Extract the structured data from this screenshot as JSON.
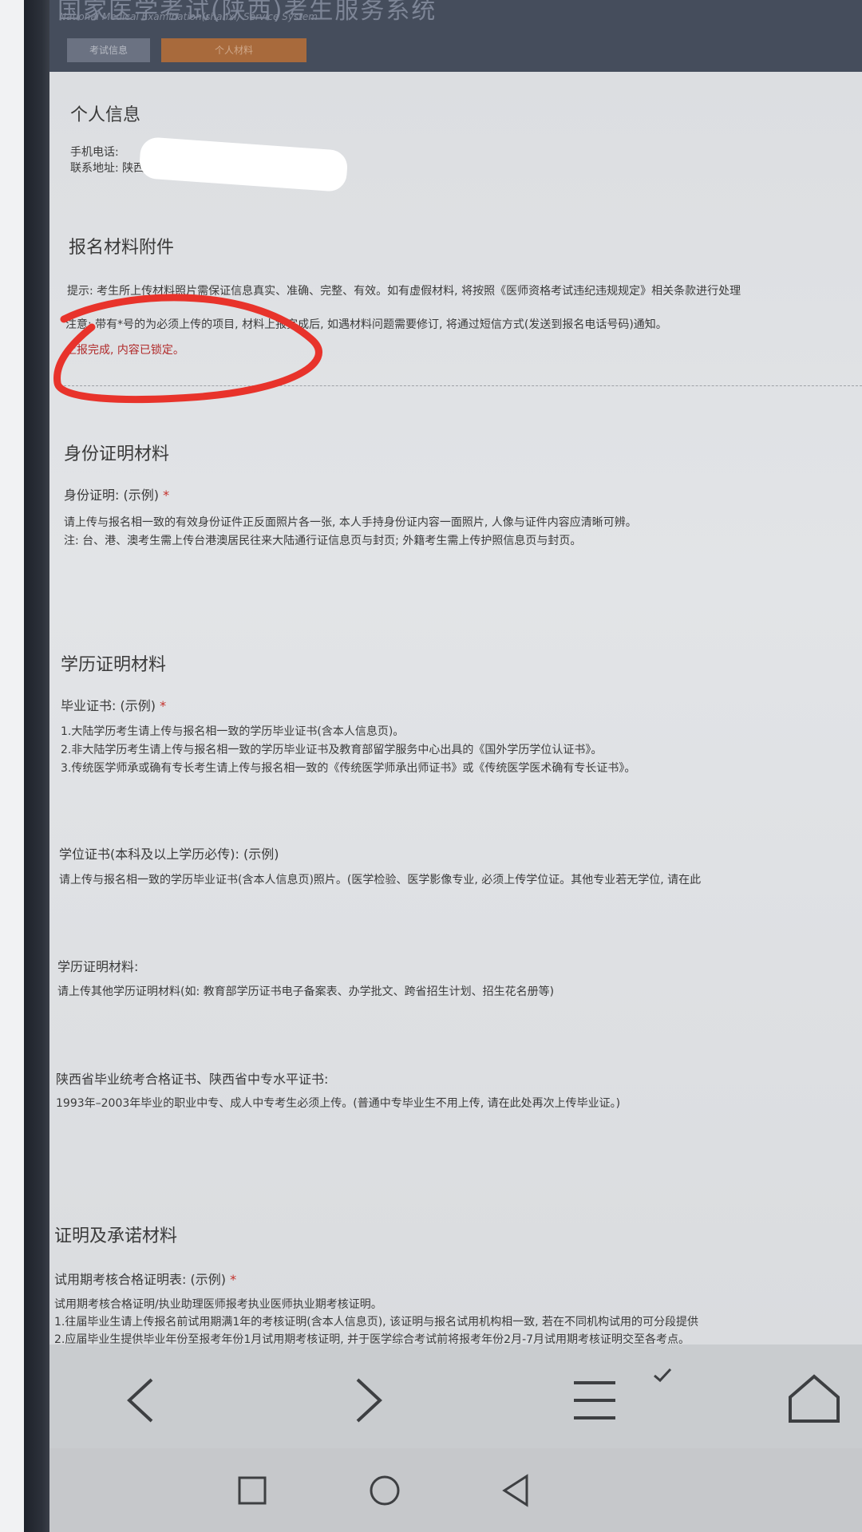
{
  "header": {
    "title": "国家医学考试(陕西)考生服务系统",
    "subtitle": "National Medical Examination(shanxi) Service System",
    "tabs": [
      {
        "label": "考试信息"
      },
      {
        "label": "个人材料"
      }
    ]
  },
  "personal": {
    "heading": "个人信息",
    "phone_label": "手机电话:",
    "address_label": "联系地址: 陕西"
  },
  "attachments": {
    "heading": "报名材料附件",
    "tip": "提示: 考生所上传材料照片需保证信息真实、准确、完整、有效。如有虚假材料, 将按照《医师资格考试违纪违规规定》相关条款进行处理",
    "note": "注意: 带有*号的为必须上传的项目, 材料上报完成后, 如遇材料问题需要修订, 将通过短信方式(发送到报名电话号码)通知。",
    "locked": "上报完成, 内容已锁定。"
  },
  "identity": {
    "heading": "身份证明材料",
    "label": "身份证明: (示例)",
    "star": "*",
    "line1": "请上传与报名相一致的有效身份证件正反面照片各一张, 本人手持身份证内容一面照片, 人像与证件内容应清晰可辨。",
    "line2": "注: 台、港、澳考生需上传台港澳居民往来大陆通行证信息页与封页; 外籍考生需上传护照信息页与封页。"
  },
  "education": {
    "heading": "学历证明材料",
    "diploma_label": "毕业证书: (示例)",
    "diploma_star": "*",
    "diploma_lines": [
      "1.大陆学历考生请上传与报名相一致的学历毕业证书(含本人信息页)。",
      "2.非大陆学历考生请上传与报名相一致的学历毕业证书及教育部留学服务中心出具的《国外学历学位认证书》。",
      "3.传统医学师承或确有专长考生请上传与报名相一致的《传统医学师承出师证书》或《传统医学医术确有专长证书》。"
    ],
    "degree_label": "学位证书(本科及以上学历必传): (示例)",
    "degree_line": "请上传与报名相一致的学历毕业证书(含本人信息页)照片。(医学检验、医学影像专业, 必须上传学位证。其他专业若无学位, 请在此",
    "other_label": "学历证明材料:",
    "other_line": "请上传其他学历证明材料(如: 教育部学历证书电子备案表、办学批文、跨省招生计划、招生花名册等)",
    "shaanxi_label": "陕西省毕业统考合格证书、陕西省中专水平证书:",
    "shaanxi_line": "1993年–2003年毕业的职业中专、成人中专考生必须上传。(普通中专毕业生不用上传, 请在此处再次上传毕业证。)"
  },
  "commitment": {
    "heading": "证明及承诺材料",
    "label": "试用期考核合格证明表: (示例)",
    "star": "*",
    "lines": [
      "试用期考核合格证明/执业助理医师报考执业医师执业期考核证明。",
      "1.往届毕业生请上传报名前试用期满1年的考核证明(含本人信息页), 该证明与报名试用机构相一致, 若在不同机构试用的可分段提供",
      "2.应届毕业生提供毕业年份至报考年份1月试用期考核证明, 并于医学综合考试前将报考年份2月-7月试用期考核证明交至各考点。"
    ]
  },
  "colors": {
    "header_bg": "#454d5c",
    "tab_active": "#a86a3c",
    "required_star": "#c4302b",
    "annotation": "#e8332b"
  }
}
